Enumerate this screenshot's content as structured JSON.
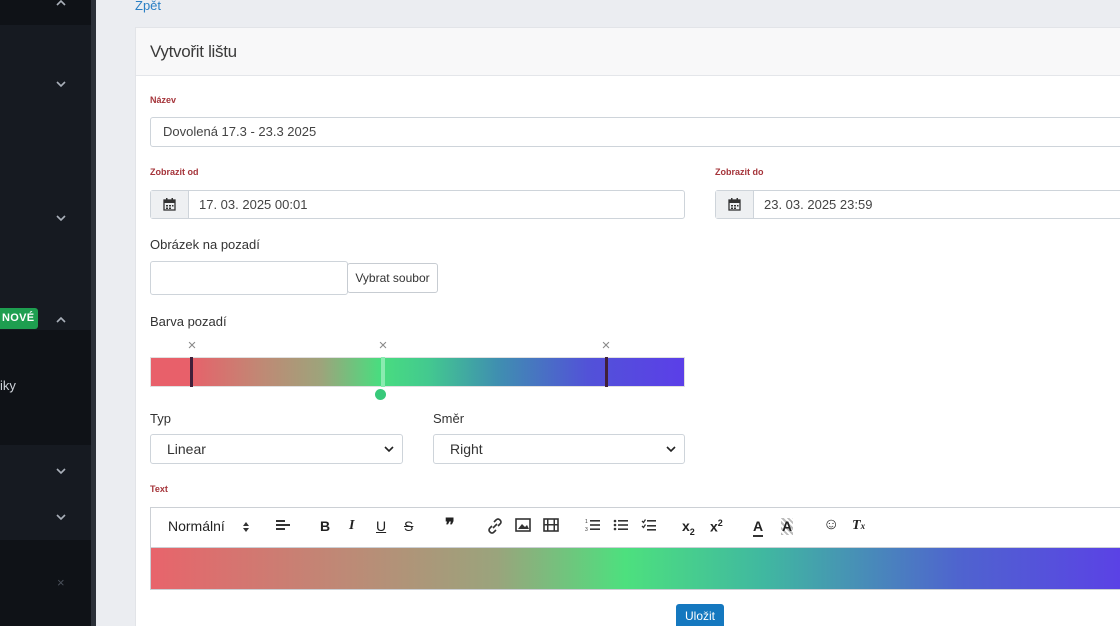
{
  "nav": {
    "back_label": "Zpět"
  },
  "sidebar": {
    "badge_new": "NOVÉ",
    "item_fragment": "iky",
    "close_glyph": "×"
  },
  "card": {
    "title": "Vytvořit lištu"
  },
  "form": {
    "name_label": "Název",
    "name_value": "Dovolená 17.3 - 23.3 2025",
    "show_from_label": "Zobrazit od",
    "show_from_value": "17. 03. 2025 00:01",
    "show_to_label": "Zobrazit do",
    "show_to_value": "23. 03. 2025 23:59",
    "bg_image_label": "Obrázek na pozadí",
    "file_button_label": "Vybrat soubor",
    "bg_color_label": "Barva pozadí",
    "gradient_stops": [
      {
        "color": "#e8606a",
        "position": 0.07
      },
      {
        "color": "#49dd7f",
        "position": 0.43,
        "selected": true
      },
      {
        "color": "#5b3fe8",
        "position": 0.85
      }
    ],
    "type_label": "Typ",
    "type_value": "Linear",
    "direction_label": "Směr",
    "direction_value": "Right",
    "text_label": "Text",
    "format_select_value": "Normální",
    "save_label": "Uložit"
  },
  "colors": {
    "accent": "#1578bf",
    "required_label": "#a5343a",
    "badge": "#1e9e50"
  }
}
